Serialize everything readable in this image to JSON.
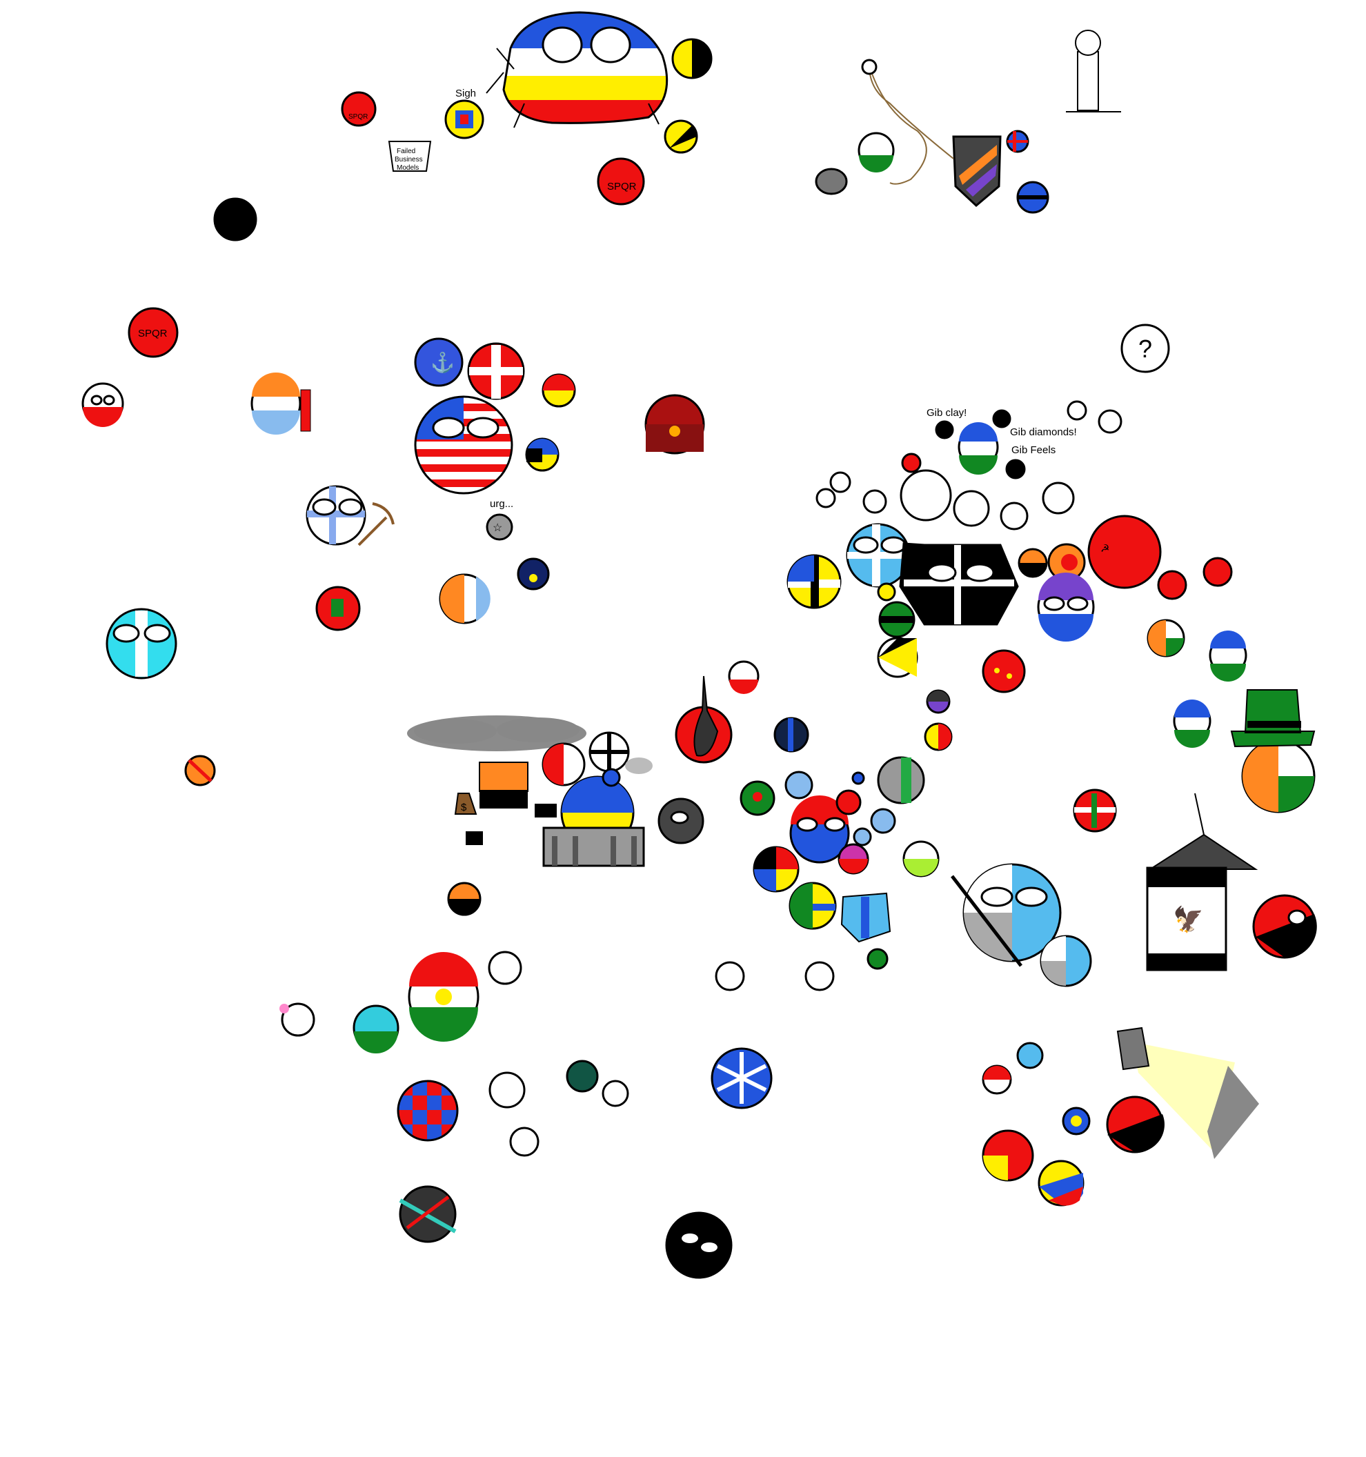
{
  "palette": {
    "white": "#ffffff",
    "black": "#000000",
    "red": "#ee1111",
    "yellow": "#ffee00",
    "blue": "#2255dd",
    "lightblue": "#55bbee",
    "cyan": "#33ddee",
    "green": "#118822",
    "orange": "#ff8822",
    "gray": "#888888",
    "darkred": "#aa1111",
    "purple": "#7744cc"
  },
  "texts": {
    "sigh": "Sigh",
    "failed_business_models": [
      "Failed",
      "Business",
      "Models"
    ],
    "fk": "FK",
    "spqr": "SPQR",
    "urg": "urg...",
    "gib_clay": "Gib clay!",
    "gib_diamonds": "Gib diamonds!",
    "gib_feels": "Gib Feels",
    "question_mark": "?",
    "dollar": "$"
  },
  "icons": {
    "crown": "crown-icon",
    "chain": "chain-icon",
    "cloud": "smoke-cloud-icon",
    "spotlight": "spotlight-icon",
    "guitar": "guitar-icon",
    "pickelhaube": "pickelhaube-helmet-icon",
    "leprechaun_hat": "leprechaun-hat-icon",
    "statue": "statue-icon",
    "pickaxe": "pickaxe-icon",
    "eagle": "eagle-icon",
    "pentagram": "pentagram-icon"
  }
}
